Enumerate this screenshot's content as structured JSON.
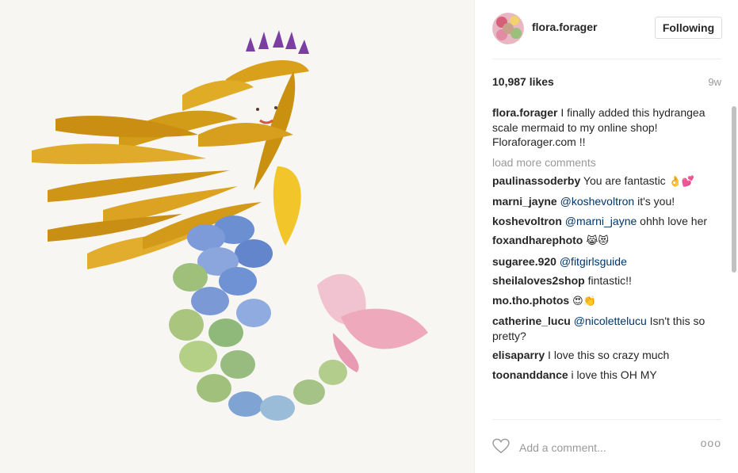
{
  "post": {
    "image_description_icon": "flower-petal-mermaid-image"
  },
  "header": {
    "username": "flora.forager",
    "follow_label": "Following"
  },
  "stats": {
    "likes": "10,987 likes",
    "ago": "9w"
  },
  "caption": {
    "user": "flora.forager",
    "text": " I finally added this hydrangea scale mermaid to my online shop! Floraforager.com !!"
  },
  "load_more": "load more comments",
  "comments": [
    {
      "user": "paulinassoderby",
      "text": " You are fantastic ",
      "emoji": "👌💕"
    },
    {
      "user": "marni_jayne",
      "mention": "@koshevoltron",
      "text": " it's you!"
    },
    {
      "user": "koshevoltron",
      "mention": "@marni_jayne",
      "text": " ohhh love her"
    },
    {
      "user": "foxandharephoto",
      "text": " ",
      "emoji": "😹😻"
    },
    {
      "user": "sugaree.920",
      "mention": "@fitgirlsguide",
      "text": ""
    },
    {
      "user": "sheilaloves2shop",
      "text": " fintastic!!"
    },
    {
      "user": "mo.tho.photos",
      "text": " ",
      "emoji": "😍👏"
    },
    {
      "user": "catherine_lucu",
      "mention": "@nicolettelucu",
      "text": " Isn't this so pretty?"
    },
    {
      "user": "elisaparry",
      "text": " I love this so crazy much"
    },
    {
      "user": "toonanddance",
      "text": " i love this OH MY"
    }
  ],
  "comment_box": {
    "placeholder": "Add a comment...",
    "more_label": "ooo"
  },
  "colors": {
    "link": "#003569",
    "muted": "#999999",
    "text": "#262626",
    "border": "#dbdbdb"
  }
}
